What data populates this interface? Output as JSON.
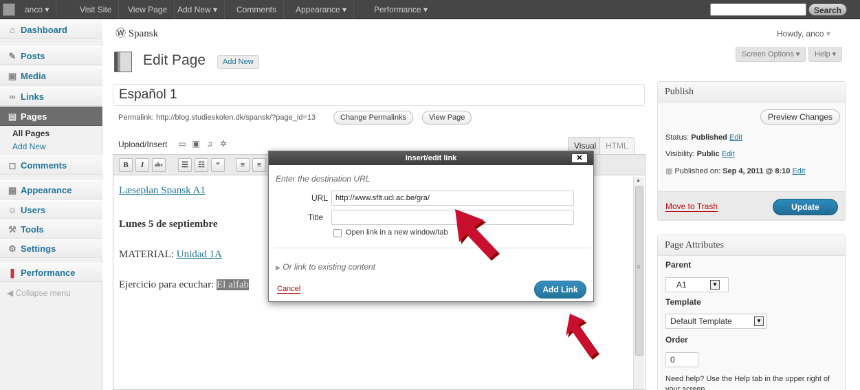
{
  "adminbar": {
    "user": "anco",
    "visit_site": "Visit Site",
    "view_page": "View Page",
    "add_new": "Add New",
    "comments": "Comments",
    "appearance": "Appearance",
    "performance": "Performance",
    "search_btn": "Search"
  },
  "menu": {
    "dashboard": "Dashboard",
    "posts": "Posts",
    "media": "Media",
    "links": "Links",
    "pages": "Pages",
    "all_pages": "All Pages",
    "add_new": "Add New",
    "comments": "Comments",
    "appearance": "Appearance",
    "users": "Users",
    "tools": "Tools",
    "settings": "Settings",
    "performance": "Performance",
    "collapse": "Collapse menu"
  },
  "header": {
    "site": "Spansk",
    "howdy": "Howdy, anco",
    "screen_options": "Screen Options",
    "help": "Help",
    "title": "Edit Page",
    "add_new": "Add New"
  },
  "edit": {
    "post_title": "Español 1",
    "permalink": "Permalink: http://blog.studieskolen.dk/spansk/?page_id=13",
    "change_permalinks": "Change Permalinks",
    "view_page": "View Page",
    "upload_insert": "Upload/Insert",
    "tab_visual": "Visual",
    "tab_html": "HTML"
  },
  "content": {
    "line1": "Læseplan Spansk A1",
    "line2": "Lunes 5 de septiembre",
    "line3_prefix": "MATERIAL: ",
    "line3_link": "Unidad 1A",
    "line4_prefix": "Ejercicio para ecuchar: ",
    "line4_hl": "El alfab"
  },
  "dialog": {
    "title": "Insert/edit link",
    "close": "✕",
    "hint": "Enter the destination URL",
    "url_label": "URL",
    "url_value": "http://www.sflt.ucl.ac.be/gra/",
    "title_label": "Title",
    "title_value": "",
    "new_tab": "Open link in a new window/tab",
    "existing": "Or link to existing content",
    "cancel": "Cancel",
    "add_link": "Add Link"
  },
  "publish": {
    "heading": "Publish",
    "preview": "Preview Changes",
    "status_label": "Status: ",
    "status_value": "Published",
    "visibility_label": "Visibility: ",
    "visibility_value": "Public",
    "published_label": "Published on: ",
    "published_value": "Sep 4, 2011 @ 8:10",
    "edit": "Edit",
    "trash": "Move to Trash",
    "update": "Update"
  },
  "attributes": {
    "heading": "Page Attributes",
    "parent_label": "Parent",
    "parent_value": "A1",
    "template_label": "Template",
    "template_value": "Default Template",
    "order_label": "Order",
    "order_value": "0",
    "help": "Need help? Use the Help tab in the upper right of your screen."
  },
  "colors": {
    "accent": "#21759b",
    "annotation_arrow": "#c8102e"
  }
}
